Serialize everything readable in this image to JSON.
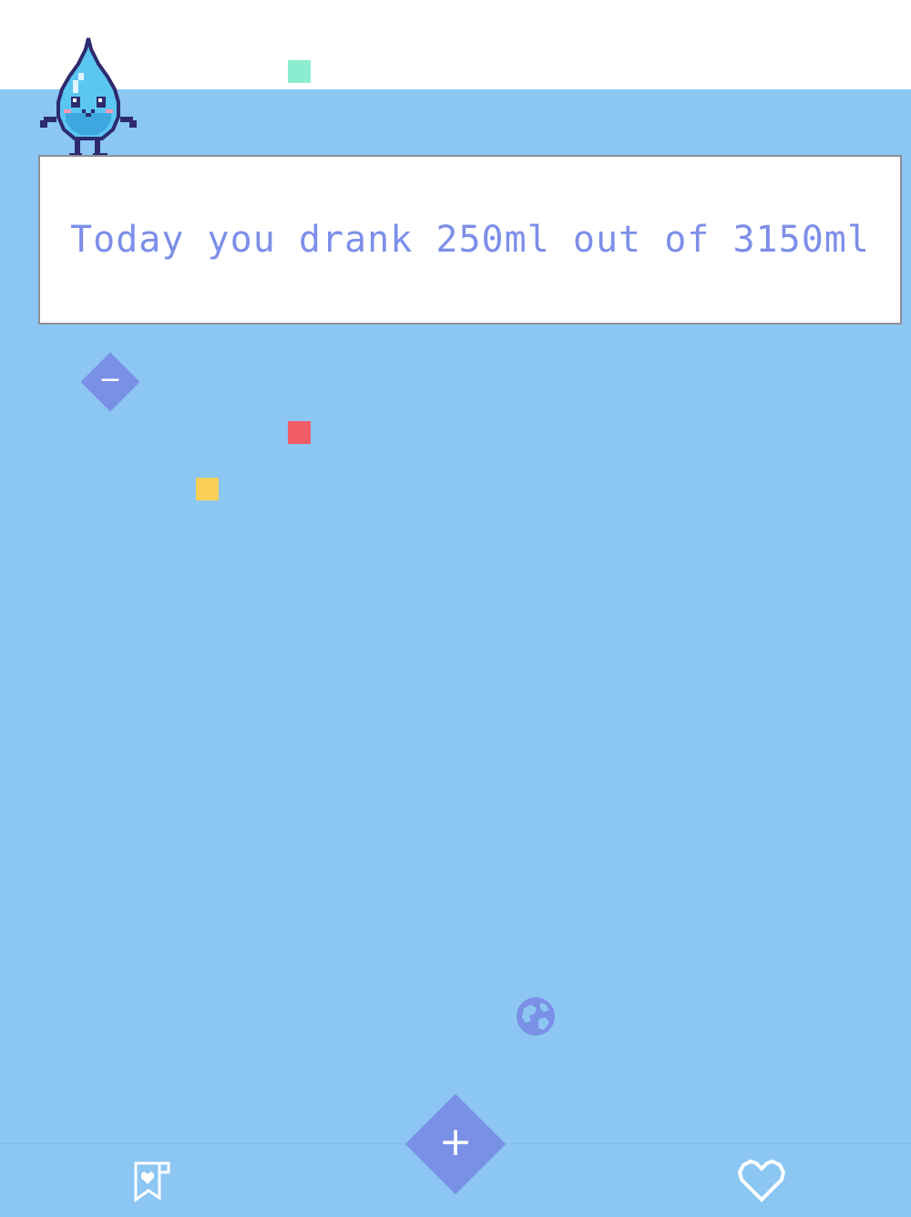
{
  "message": {
    "text": "Today you drank 250ml out of 3150ml"
  },
  "buttons": {
    "decrease_label": "−",
    "add_label": "+"
  },
  "icons": {
    "mascot": "water-drop-mascot",
    "globe": "globe-icon",
    "log": "bookmark-heart-icon",
    "favorites": "heart-icon"
  },
  "colors": {
    "background": "#8cc6f3",
    "accent": "#7a90e6",
    "text": "#7d8fe8",
    "pixel_green": "#8cecd0",
    "pixel_red": "#f25c66",
    "pixel_yellow": "#f9cf58"
  }
}
